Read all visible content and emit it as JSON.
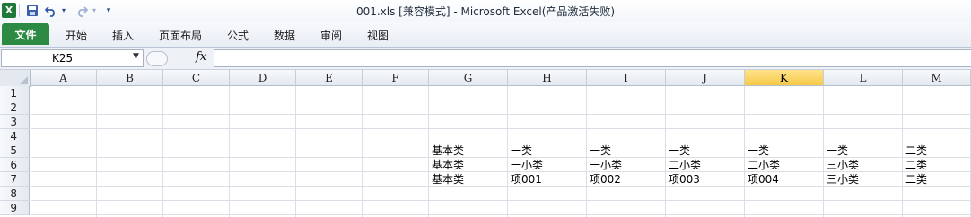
{
  "app": {
    "logo_letter": "X",
    "title": "001.xls  [兼容模式]  -  Microsoft Excel(产品激活失败)"
  },
  "qat": {
    "save_icon": "save-icon",
    "undo_icon": "undo-icon",
    "redo_icon": "redo-icon",
    "customize_icon": "customize-qat-icon"
  },
  "ribbon": {
    "tabs": [
      "文件",
      "开始",
      "插入",
      "页面布局",
      "公式",
      "数据",
      "审阅",
      "视图"
    ]
  },
  "formula_bar": {
    "name_box": "K25",
    "fx_label": "fx",
    "formula": ""
  },
  "sheet": {
    "columns": [
      "A",
      "B",
      "C",
      "D",
      "E",
      "F",
      "G",
      "H",
      "I",
      "J",
      "K",
      "L",
      "M"
    ],
    "selected_column": "K",
    "rows": [
      "1",
      "2",
      "3",
      "4",
      "5",
      "6",
      "7",
      "8",
      "9"
    ],
    "cells": [
      {
        "ref": "G5",
        "value": "基本类"
      },
      {
        "ref": "H5",
        "value": "一类"
      },
      {
        "ref": "I5",
        "value": "一类"
      },
      {
        "ref": "J5",
        "value": "一类"
      },
      {
        "ref": "K5",
        "value": "一类"
      },
      {
        "ref": "L5",
        "value": "一类"
      },
      {
        "ref": "M5",
        "value": "二类"
      },
      {
        "ref": "G6",
        "value": "基本类"
      },
      {
        "ref": "H6",
        "value": "一小类"
      },
      {
        "ref": "I6",
        "value": "一小类"
      },
      {
        "ref": "J6",
        "value": "二小类"
      },
      {
        "ref": "K6",
        "value": "二小类"
      },
      {
        "ref": "L6",
        "value": "三小类"
      },
      {
        "ref": "M6",
        "value": "二类"
      },
      {
        "ref": "G7",
        "value": "基本类"
      },
      {
        "ref": "H7",
        "value": "项001"
      },
      {
        "ref": "I7",
        "value": "项002"
      },
      {
        "ref": "J7",
        "value": "项003"
      },
      {
        "ref": "K7",
        "value": "项004"
      },
      {
        "ref": "L7",
        "value": "三小类"
      },
      {
        "ref": "M7",
        "value": "二类"
      }
    ]
  }
}
